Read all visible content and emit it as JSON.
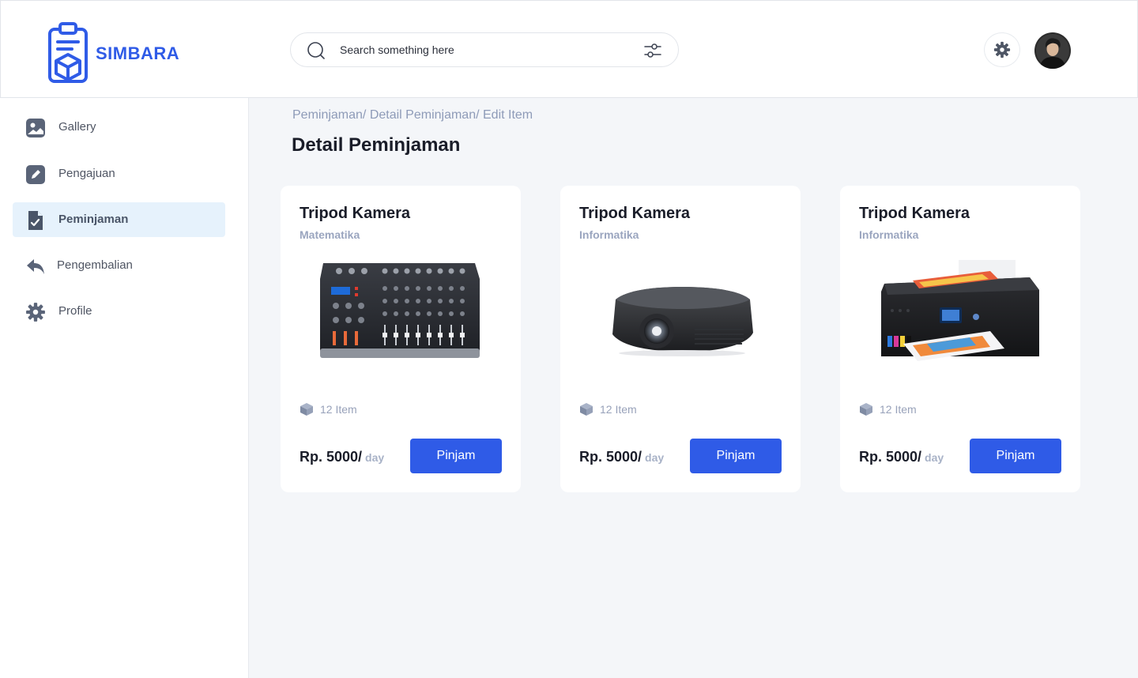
{
  "app": {
    "name": "SIMBARA",
    "accent": "#2F5BE7"
  },
  "search": {
    "placeholder": "Search something here"
  },
  "sidebar": {
    "items": [
      {
        "label": "Gallery",
        "icon": "image-icon"
      },
      {
        "label": "Pengajuan",
        "icon": "edit-icon"
      },
      {
        "label": "Peminjaman",
        "icon": "document-check-icon",
        "active": true
      },
      {
        "label": "Pengembalian",
        "icon": "reply-icon"
      },
      {
        "label": "Profile",
        "icon": "gear-icon"
      }
    ]
  },
  "breadcrumb": "Peminjaman/ Detail Peminjaman/ Edit Item",
  "page_title": "Detail Peminjaman",
  "cards": [
    {
      "title": "Tripod Kamera",
      "subtitle": "Matematika",
      "image": "audio-mixer",
      "stock": "12 Item",
      "price": "Rp. 5000/",
      "unit": "day",
      "button": "Pinjam"
    },
    {
      "title": "Tripod Kamera",
      "subtitle": "Informatika",
      "image": "projector",
      "stock": "12 Item",
      "price": "Rp. 5000/",
      "unit": "day",
      "button": "Pinjam"
    },
    {
      "title": "Tripod Kamera",
      "subtitle": "Informatika",
      "image": "printer",
      "stock": "12 Item",
      "price": "Rp. 5000/",
      "unit": "day",
      "button": "Pinjam"
    }
  ]
}
